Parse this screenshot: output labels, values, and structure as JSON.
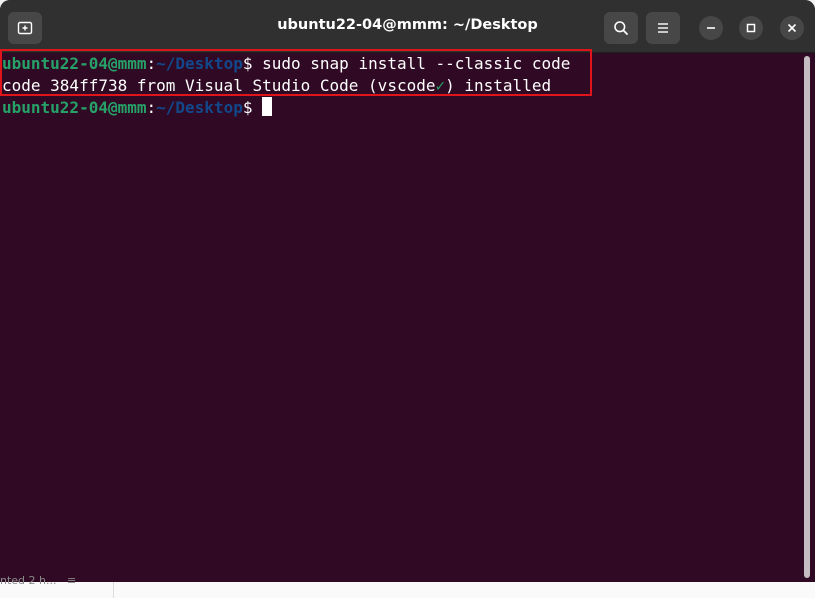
{
  "window": {
    "title": "ubuntu22-04@mmm: ~/Desktop"
  },
  "titlebar": {
    "new_tab_icon": "new-tab-icon",
    "search_icon": "search-icon",
    "menu_icon": "hamburger-menu-icon",
    "minimize_icon": "minimize-icon",
    "maximize_icon": "maximize-icon",
    "close_icon": "close-icon"
  },
  "terminal": {
    "lines": [
      {
        "user": "ubuntu22-04@mmm",
        "sep": ":",
        "path": "~/Desktop",
        "prompt": "$",
        "command": " sudo snap install --classic code"
      },
      {
        "output_before": "code 384ff738 from Visual Studio Code (vscode",
        "check": "✓",
        "output_after": ") installed"
      },
      {
        "user": "ubuntu22-04@mmm",
        "sep": ":",
        "path": "~/Desktop",
        "prompt": "$ "
      }
    ]
  },
  "background": {
    "partial_text": "nted 2 h...   ≡"
  },
  "colors": {
    "terminal_bg": "#300a24",
    "titlebar_bg": "#303030",
    "user_green": "#26a269",
    "path_blue": "#12488b",
    "highlight_red": "#e0151b"
  }
}
